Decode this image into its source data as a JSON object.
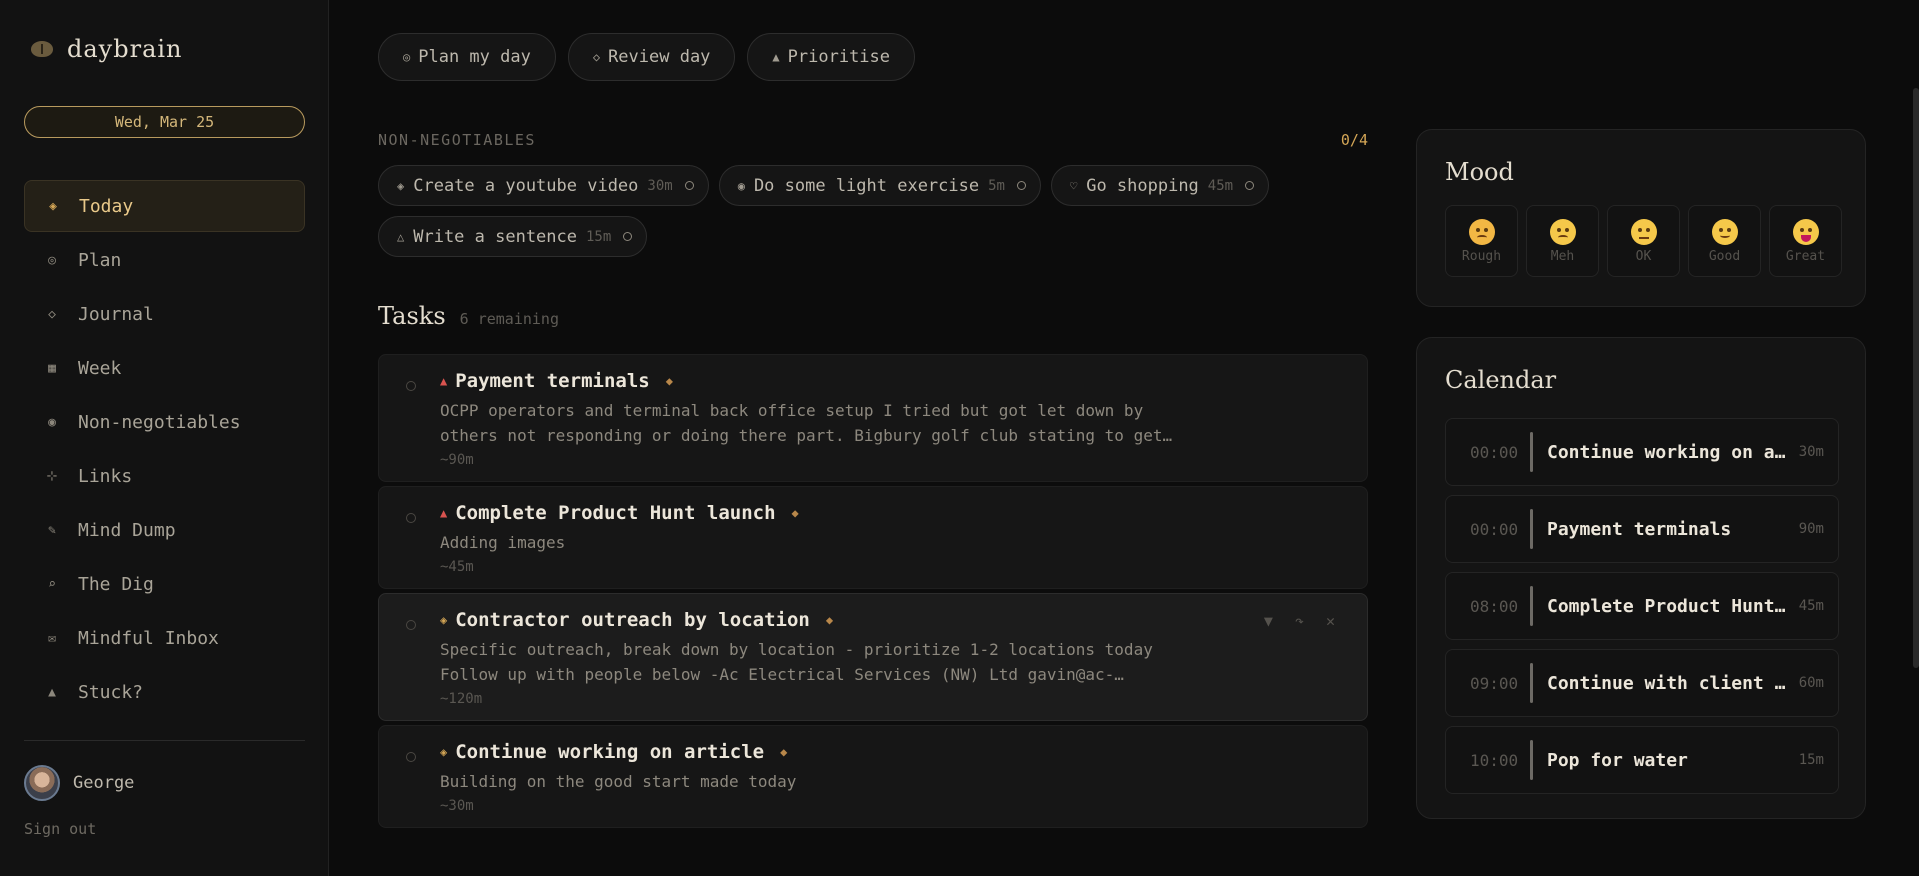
{
  "brand": {
    "name": "daybrain"
  },
  "date_label": "Wed, Mar 25",
  "nav": [
    {
      "icon": "◈",
      "label": "Today",
      "active": true
    },
    {
      "icon": "◎",
      "label": "Plan"
    },
    {
      "icon": "◇",
      "label": "Journal"
    },
    {
      "icon": "▦",
      "label": "Week"
    },
    {
      "icon": "◉",
      "label": "Non-negotiables"
    },
    {
      "icon": "⊹",
      "label": "Links"
    },
    {
      "icon": "✎",
      "label": "Mind Dump"
    },
    {
      "icon": "⌕",
      "label": "The Dig"
    },
    {
      "icon": "✉",
      "label": "Mindful Inbox"
    },
    {
      "icon": "▲",
      "label": "Stuck?"
    }
  ],
  "user": {
    "name": "George",
    "signout": "Sign out"
  },
  "actions": [
    {
      "icon": "◎",
      "label": "Plan my day"
    },
    {
      "icon": "◇",
      "label": "Review day"
    },
    {
      "icon": "▲",
      "label": "Prioritise"
    }
  ],
  "non_negotiables": {
    "title": "NON-NEGOTIABLES",
    "count": "0/4",
    "items": [
      {
        "icon": "◈",
        "label": "Create a youtube video",
        "duration": "30m"
      },
      {
        "icon": "◉",
        "label": "Do some light exercise",
        "duration": "5m"
      },
      {
        "icon": "♡",
        "label": "Go shopping",
        "duration": "45m"
      },
      {
        "icon": "△",
        "label": "Write a sentence",
        "duration": "15m"
      }
    ]
  },
  "tasks": {
    "title": "Tasks",
    "remaining": "6 remaining",
    "items": [
      {
        "priority": "high",
        "prio_icon": "▲",
        "title": "Payment terminals",
        "star": "◆",
        "description": "OCPP operators and terminal back office setup I tried but got let down by\nothers not responding or doing there part. Bigbury golf club stating to get…",
        "duration": "~90m"
      },
      {
        "priority": "high",
        "prio_icon": "▲",
        "title": "Complete Product Hunt launch",
        "star": "◆",
        "description": "Adding images",
        "duration": "~45m"
      },
      {
        "priority": "mid",
        "prio_icon": "◈",
        "title": "Contractor outreach by location",
        "star": "◆",
        "description": "Specific outreach, break down by location - prioritize 1-2 locations today\nFollow up with people below -Ac Electrical Services (NW) Ltd gavin@ac-…",
        "duration": "~120m",
        "hover": true,
        "action_icons": [
          "▼",
          "↷",
          "✕"
        ]
      },
      {
        "priority": "mid",
        "prio_icon": "◈",
        "title": "Continue working on article",
        "star": "◆",
        "description": "Building on the good start made today",
        "duration": "~30m"
      }
    ]
  },
  "mood": {
    "title": "Mood",
    "options": [
      {
        "label": "Rough",
        "mouth": "frown"
      },
      {
        "label": "Meh",
        "mouth": "frown"
      },
      {
        "label": "OK",
        "mouth": "flat"
      },
      {
        "label": "Good",
        "mouth": "smile"
      },
      {
        "label": "Great",
        "mouth": "grin"
      }
    ]
  },
  "calendar": {
    "title": "Calendar",
    "events": [
      {
        "time": "00:00",
        "title": "Continue working on article",
        "duration": "30m"
      },
      {
        "time": "00:00",
        "title": "Payment terminals",
        "duration": "90m"
      },
      {
        "time": "08:00",
        "title": "Complete Product Hunt launch",
        "duration": "45m"
      },
      {
        "time": "09:00",
        "title": "Continue with client outreach",
        "duration": "60m"
      },
      {
        "time": "10:00",
        "title": "Pop for water",
        "duration": "15m"
      }
    ]
  }
}
